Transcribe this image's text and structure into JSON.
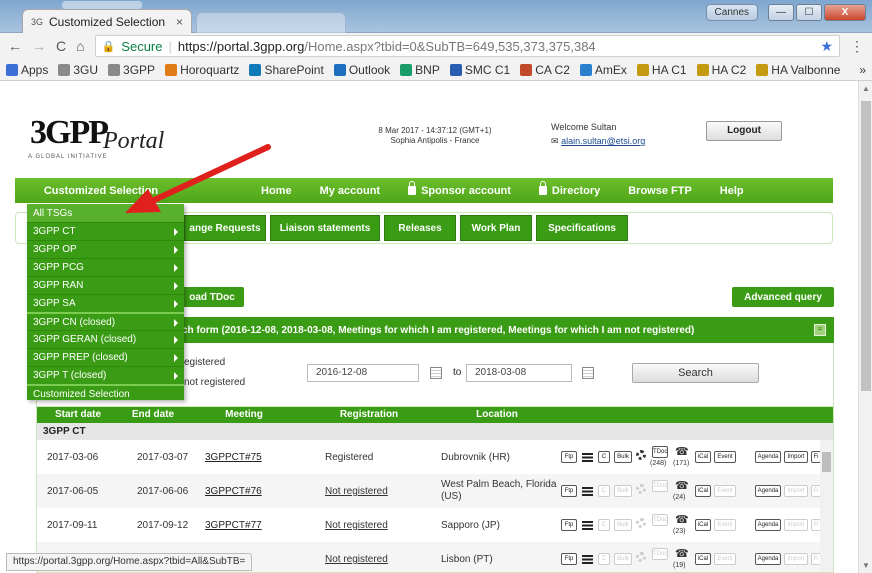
{
  "browser": {
    "tab_title": "Customized Selection",
    "tab_close": "×",
    "nav_back": "←",
    "nav_forward": "→",
    "nav_reload": "C",
    "nav_home": "⌂",
    "secure_label": "Secure",
    "url_host": "https://portal.3gpp.org",
    "url_path": "/Home.aspx?tbid=0&SubTB=649,535,373,375,384",
    "menu_icon": "⋮",
    "user_chip": "Cannes",
    "win_minimize": "—",
    "win_maximize": "☐",
    "win_close": "X"
  },
  "bookmarks": [
    {
      "label": "Apps",
      "color": "#3b6fd6"
    },
    {
      "label": "3GU",
      "color": "#8a8a8a"
    },
    {
      "label": "3GPP",
      "color": "#8a8a8a"
    },
    {
      "label": "Horoquartz",
      "color": "#e07b16"
    },
    {
      "label": "SharePoint",
      "color": "#0f7ab8"
    },
    {
      "label": "Outlook",
      "color": "#1e6fc0"
    },
    {
      "label": "BNP",
      "color": "#1a9c6a"
    },
    {
      "label": "SMC C1",
      "color": "#2a5db0"
    },
    {
      "label": "CA C2",
      "color": "#c04a2a"
    },
    {
      "label": "AmEx",
      "color": "#2b7fcf"
    },
    {
      "label": "HA C1",
      "color": "#c49a10"
    },
    {
      "label": "HA C2",
      "color": "#c49a10"
    },
    {
      "label": "HA Valbonne",
      "color": "#c49a10"
    }
  ],
  "bookmarks_more": "»",
  "header": {
    "logo_text": "3GPP",
    "logo_sub": "A GLOBAL INITIATIVE",
    "portal_text": "Portal",
    "datetime_line1": "8 Mar 2017 - 14:37:12 (GMT+1)",
    "datetime_line2": "Sophia Antipolis - France",
    "welcome": "Welcome Sultan",
    "email": "alain.sultan@etsi.org",
    "logout": "Logout"
  },
  "navbar": [
    {
      "label": "Customized Selection",
      "lock": false
    },
    {
      "label": "Home",
      "lock": false
    },
    {
      "label": "My account",
      "lock": false
    },
    {
      "label": "Sponsor account",
      "lock": true
    },
    {
      "label": "Directory",
      "lock": true
    },
    {
      "label": "Browse FTP",
      "lock": false
    },
    {
      "label": "Help",
      "lock": false
    }
  ],
  "tabs": {
    "change_requests": "ange Requests",
    "liaison": "Liaison statements",
    "releases": "Releases",
    "work_plan": "Work Plan",
    "specifications": "Specifications"
  },
  "actions": {
    "upload": "oad TDoc",
    "advanced": "Advanced query"
  },
  "search": {
    "title": "ch form (2016-12-08, 2018-03-08, Meetings for which I am registered, Meetings for which I am not registered)",
    "collapse": "≈",
    "opt_registered": "egistered",
    "opt_not_registered": "not registered",
    "from_date": "2016-12-08",
    "to_label": "to",
    "to_date": "2018-03-08",
    "search_button": "Search"
  },
  "grid": {
    "columns": [
      "Start date",
      "End date",
      "Meeting",
      "Registration",
      "Location"
    ],
    "group": "3GPP CT",
    "rows": [
      {
        "start": "2017-03-06",
        "end": "2017-03-07",
        "meeting": "3GPPCT#75",
        "registration": "Registered",
        "location": "Dubrovnik (HR)",
        "tdoc_count": "(248)",
        "people_count": "(171)",
        "active": true
      },
      {
        "start": "2017-06-05",
        "end": "2017-06-06",
        "meeting": "3GPPCT#76",
        "registration": "Not registered",
        "location": "West Palm Beach, Florida (US)",
        "tdoc_count": "",
        "people_count": "(24)",
        "active": false
      },
      {
        "start": "2017-09-11",
        "end": "2017-09-12",
        "meeting": "3GPPCT#77",
        "registration": "Not registered",
        "location": "Sapporo (JP)",
        "tdoc_count": "",
        "people_count": "(23)",
        "active": false
      },
      {
        "start": "",
        "end": "",
        "meeting": "",
        "registration": "Not registered",
        "location": "Lisbon (PT)",
        "tdoc_count": "",
        "people_count": "(19)",
        "active": false
      }
    ],
    "btn_ftp": "Ftp",
    "btn_c": "C",
    "btn_bulk": "Bulk",
    "btn_tdoc": "TDoc",
    "btn_ical": "iCal",
    "btn_event": "Event",
    "btn_agenda": "Agenda",
    "btn_import": "Import",
    "btn_fi": "Fi"
  },
  "dropdown": {
    "items": [
      {
        "label": "All TSGs",
        "submenu": false
      },
      {
        "label": "3GPP CT",
        "submenu": true
      },
      {
        "label": "3GPP OP",
        "submenu": true
      },
      {
        "label": "3GPP PCG",
        "submenu": true
      },
      {
        "label": "3GPP RAN",
        "submenu": true
      },
      {
        "label": "3GPP SA",
        "submenu": true
      },
      {
        "label": "3GPP CN (closed)",
        "submenu": true
      },
      {
        "label": "3GPP GERAN (closed)",
        "submenu": true
      },
      {
        "label": "3GPP PREP (closed)",
        "submenu": true
      },
      {
        "label": "3GPP T (closed)",
        "submenu": true
      },
      {
        "label": "Customized Selection",
        "submenu": false
      }
    ]
  },
  "status_url": "https://portal.3gpp.org/Home.aspx?tbid=All&SubTB=",
  "colors": {
    "green": "#3a9c14",
    "nav_green": "#5cb323",
    "arrow_red": "#e0201c"
  }
}
